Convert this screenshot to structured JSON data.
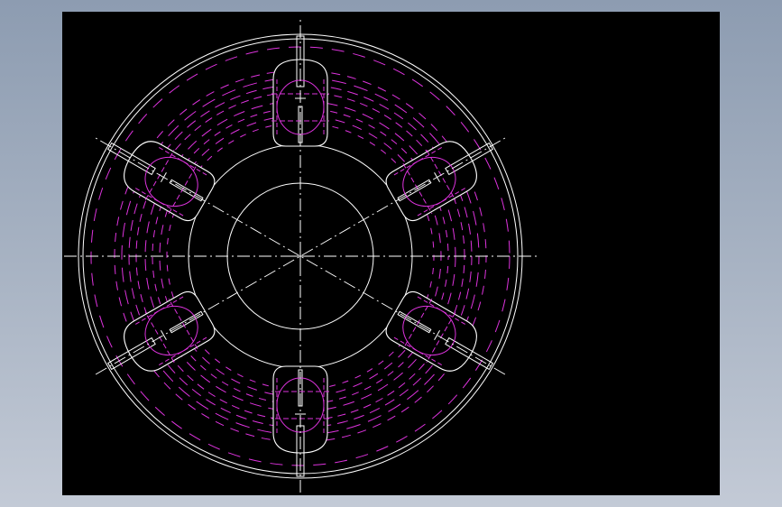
{
  "drawing": {
    "background": "#000000",
    "outline_color": "#ffffff",
    "hidden_line_color": "#dd33dd",
    "centerline_color": "#ffffff",
    "pocket_count": 6,
    "pocket_angles_deg": [
      90,
      30,
      -30,
      -90,
      -150,
      150
    ],
    "centerline_angles_deg": [
      0,
      30,
      90,
      150
    ]
  },
  "window": {
    "background_top": "#8d9cb1",
    "background_bottom": "#c3cad6"
  }
}
